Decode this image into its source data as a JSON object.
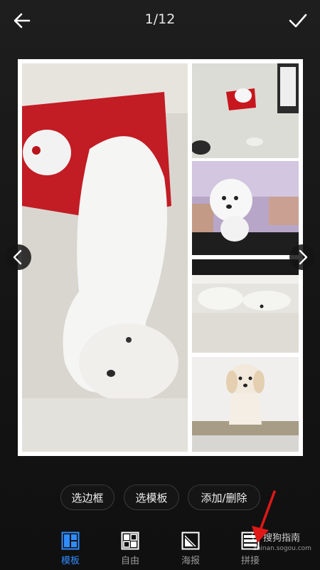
{
  "header": {
    "counter": "1/12",
    "back_icon": "arrow-left-icon",
    "confirm_icon": "check-icon"
  },
  "collage": {
    "cells": [
      {
        "name": "photo-dog-lying-on-floor"
      },
      {
        "name": "photo-dog-on-red-cushion"
      },
      {
        "name": "photo-dog-on-lap"
      },
      {
        "name": "photo-dog-under-furniture"
      },
      {
        "name": "photo-dog-sitting"
      }
    ]
  },
  "actions": {
    "border": "选边框",
    "template": "选模板",
    "add_delete": "添加/删除"
  },
  "tabs": [
    {
      "label": "模板",
      "icon": "template-grid-icon",
      "active": true
    },
    {
      "label": "自由",
      "icon": "free-layout-icon",
      "active": false
    },
    {
      "label": "海报",
      "icon": "poster-icon",
      "active": false
    },
    {
      "label": "拼接",
      "icon": "stitch-icon",
      "active": false
    }
  ],
  "watermark": {
    "text": "搜狗指南",
    "sub": "zhinan.sogou.com"
  },
  "colors": {
    "accent": "#2f8cff",
    "annotation_arrow": "#e01818"
  }
}
